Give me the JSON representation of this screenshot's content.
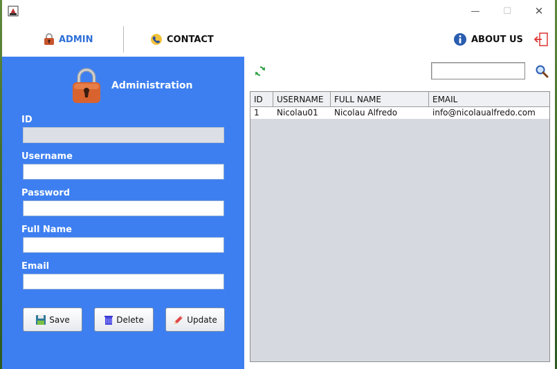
{
  "window": {
    "controls": {
      "minimize": "—",
      "maximize": "☐",
      "close": "✕"
    }
  },
  "nav": {
    "admin": "ADMIN",
    "contact": "CONTACT",
    "about": "ABOUT US"
  },
  "form": {
    "title": "Administration",
    "fields": {
      "id": {
        "label": "ID",
        "value": ""
      },
      "username": {
        "label": "Username",
        "value": ""
      },
      "password": {
        "label": "Password",
        "value": ""
      },
      "full_name": {
        "label": "Full Name",
        "value": ""
      },
      "email": {
        "label": "Email",
        "value": ""
      }
    },
    "buttons": {
      "save": "Save",
      "delete": "Delete",
      "update": "Update"
    }
  },
  "search": {
    "value": ""
  },
  "table": {
    "headers": {
      "id": "ID",
      "username": "USERNAME",
      "full_name": "FULL NAME",
      "email": "EMAIL"
    },
    "rows": [
      {
        "id": "1",
        "username": "Nicolau01",
        "full_name": "Nicolau Alfredo",
        "email": "info@nicolaualfredo.com"
      }
    ]
  },
  "colors": {
    "panel_blue": "#3d7ff0",
    "admin_accent": "#2d6fd8",
    "table_empty": "#d6d9e0"
  }
}
